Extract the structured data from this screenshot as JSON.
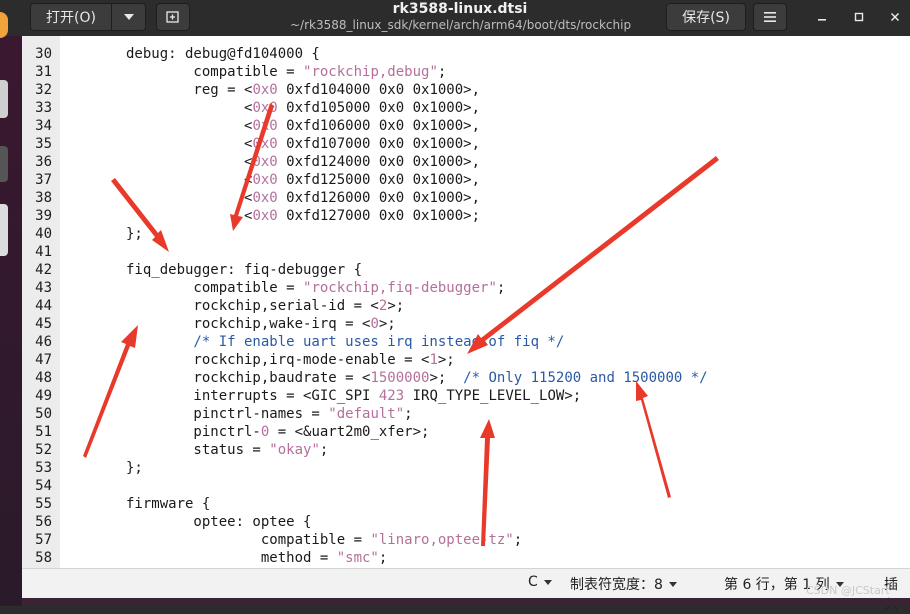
{
  "toolbar": {
    "open_label": "打开(O)",
    "save_label": "保存(S)"
  },
  "title": {
    "filename": "rk3588-linux.dtsi",
    "path": "~/rk3588_linux_sdk/kernel/arch/arm64/boot/dts/rockchip"
  },
  "icons": {
    "open_menu": "chevron-down-icon",
    "new_tab": "new-tab-icon",
    "hamburger": "hamburger-menu-icon",
    "minimize": "minimize-icon",
    "maximize": "maximize-icon",
    "close": "close-icon"
  },
  "editor": {
    "lines": [
      {
        "n": "30",
        "segs": [
          [
            "t",
            "\tdebug: debug@fd104000 {"
          ]
        ]
      },
      {
        "n": "31",
        "segs": [
          [
            "t",
            "\t\tcompatible = "
          ],
          [
            "s",
            "\"rockchip,debug\""
          ],
          [
            "t",
            ";"
          ]
        ]
      },
      {
        "n": "32",
        "segs": [
          [
            "t",
            "\t\treg = <"
          ],
          [
            "s",
            "0x0"
          ],
          [
            "t",
            " 0xfd104000 0x0 0x1000>,"
          ]
        ]
      },
      {
        "n": "33",
        "segs": [
          [
            "t",
            "\t\t      <"
          ],
          [
            "s",
            "0x0"
          ],
          [
            "t",
            " 0xfd105000 0x0 0x1000>,"
          ]
        ]
      },
      {
        "n": "34",
        "segs": [
          [
            "t",
            "\t\t      <"
          ],
          [
            "s",
            "0x0"
          ],
          [
            "t",
            " 0xfd106000 0x0 0x1000>,"
          ]
        ]
      },
      {
        "n": "35",
        "segs": [
          [
            "t",
            "\t\t      <"
          ],
          [
            "s",
            "0x0"
          ],
          [
            "t",
            " 0xfd107000 0x0 0x1000>,"
          ]
        ]
      },
      {
        "n": "36",
        "segs": [
          [
            "t",
            "\t\t      <"
          ],
          [
            "s",
            "0x0"
          ],
          [
            "t",
            " 0xfd124000 0x0 0x1000>,"
          ]
        ]
      },
      {
        "n": "37",
        "segs": [
          [
            "t",
            "\t\t      <"
          ],
          [
            "s",
            "0x0"
          ],
          [
            "t",
            " 0xfd125000 0x0 0x1000>,"
          ]
        ]
      },
      {
        "n": "38",
        "segs": [
          [
            "t",
            "\t\t      <"
          ],
          [
            "s",
            "0x0"
          ],
          [
            "t",
            " 0xfd126000 0x0 0x1000>,"
          ]
        ]
      },
      {
        "n": "39",
        "segs": [
          [
            "t",
            "\t\t      <"
          ],
          [
            "s",
            "0x0"
          ],
          [
            "t",
            " 0xfd127000 0x0 0x1000>;"
          ]
        ]
      },
      {
        "n": "40",
        "segs": [
          [
            "t",
            "\t};"
          ]
        ]
      },
      {
        "n": "41",
        "segs": [
          [
            "t",
            ""
          ]
        ]
      },
      {
        "n": "42",
        "segs": [
          [
            "t",
            "\tfiq_debugger: fiq-debugger {"
          ]
        ]
      },
      {
        "n": "43",
        "segs": [
          [
            "t",
            "\t\tcompatible = "
          ],
          [
            "s",
            "\"rockchip,fiq-debugger\""
          ],
          [
            "t",
            ";"
          ]
        ]
      },
      {
        "n": "44",
        "segs": [
          [
            "t",
            "\t\trockchip,serial-id = <"
          ],
          [
            "s",
            "2"
          ],
          [
            "t",
            ">;"
          ]
        ]
      },
      {
        "n": "45",
        "segs": [
          [
            "t",
            "\t\trockchip,wake-irq = <"
          ],
          [
            "s",
            "0"
          ],
          [
            "t",
            ">;"
          ]
        ]
      },
      {
        "n": "46",
        "segs": [
          [
            "c",
            "\t\t/* If enable uart uses irq instead of fiq */"
          ]
        ]
      },
      {
        "n": "47",
        "segs": [
          [
            "t",
            "\t\trockchip,irq-mode-enable = <"
          ],
          [
            "s",
            "1"
          ],
          [
            "t",
            ">;"
          ]
        ]
      },
      {
        "n": "48",
        "segs": [
          [
            "t",
            "\t\trockchip,baudrate = <"
          ],
          [
            "s",
            "1500000"
          ],
          [
            "t",
            ">;  "
          ],
          [
            "c",
            "/* Only 115200 and 1500000 */"
          ]
        ]
      },
      {
        "n": "49",
        "segs": [
          [
            "t",
            "\t\tinterrupts = <GIC_SPI "
          ],
          [
            "s",
            "423"
          ],
          [
            "t",
            " IRQ_TYPE_LEVEL_LOW>;"
          ]
        ]
      },
      {
        "n": "50",
        "segs": [
          [
            "t",
            "\t\tpinctrl-names = "
          ],
          [
            "s",
            "\"default\""
          ],
          [
            "t",
            ";"
          ]
        ]
      },
      {
        "n": "51",
        "segs": [
          [
            "t",
            "\t\tpinctrl-"
          ],
          [
            "s",
            "0"
          ],
          [
            "t",
            " = <&uart2m0_xfer>;"
          ]
        ]
      },
      {
        "n": "52",
        "segs": [
          [
            "t",
            "\t\tstatus = "
          ],
          [
            "s",
            "\"okay\""
          ],
          [
            "t",
            ";"
          ]
        ]
      },
      {
        "n": "53",
        "segs": [
          [
            "t",
            "\t};"
          ]
        ]
      },
      {
        "n": "54",
        "segs": [
          [
            "t",
            ""
          ]
        ]
      },
      {
        "n": "55",
        "segs": [
          [
            "t",
            "\tfirmware {"
          ]
        ]
      },
      {
        "n": "56",
        "segs": [
          [
            "t",
            "\t\toptee: optee {"
          ]
        ]
      },
      {
        "n": "57",
        "segs": [
          [
            "t",
            "\t\t\tcompatible = "
          ],
          [
            "s",
            "\"linaro,optee-tz\""
          ],
          [
            "t",
            ";"
          ]
        ]
      },
      {
        "n": "58",
        "segs": [
          [
            "t",
            "\t\t\tmethod = "
          ],
          [
            "s",
            "\"smc\""
          ],
          [
            "t",
            ";"
          ]
        ]
      }
    ]
  },
  "statusbar": {
    "language": "C",
    "tab_width": "制表符宽度：8",
    "position": "第 6 行，第 1 列",
    "mode": "插入"
  },
  "watermark": "CSDN @JCStart",
  "colors": {
    "string": "#b4709b",
    "comment": "#2a5aa5",
    "arrow": "#e8392a"
  }
}
